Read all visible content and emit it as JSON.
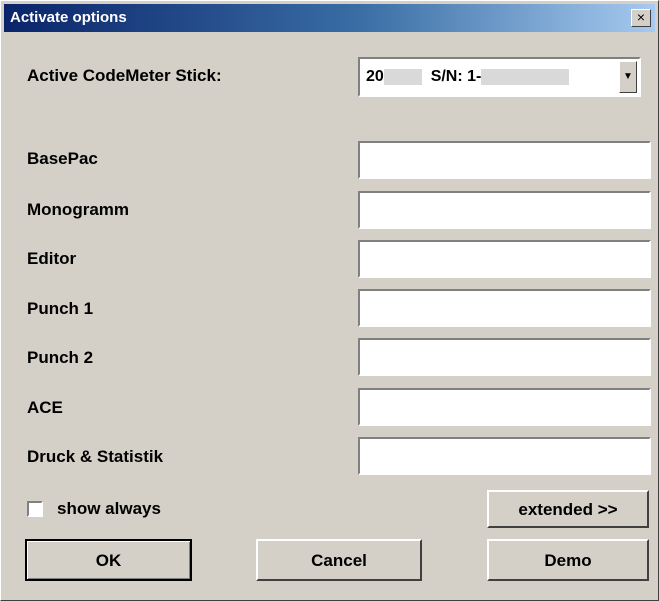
{
  "window": {
    "title": "Activate options",
    "close_glyph": "×"
  },
  "codemeter": {
    "label": "Active CodeMeter Stick:",
    "value_prefix": "20",
    "value_serial": "S/N: 1-"
  },
  "options": [
    {
      "label": "BasePac",
      "value": ""
    },
    {
      "label": "Monogramm",
      "value": ""
    },
    {
      "label": "Editor",
      "value": ""
    },
    {
      "label": "Punch 1",
      "value": ""
    },
    {
      "label": "Punch 2",
      "value": ""
    },
    {
      "label": "ACE",
      "value": ""
    },
    {
      "label": "Druck & Statistik",
      "value": ""
    }
  ],
  "show_always": {
    "label": "show always",
    "checked": false
  },
  "buttons": {
    "extended": "extended >>",
    "ok": "OK",
    "cancel": "Cancel",
    "demo": "Demo"
  },
  "colors": {
    "titlebar_start": "#0a246a",
    "dialog_bg": "#d4d0c8"
  }
}
